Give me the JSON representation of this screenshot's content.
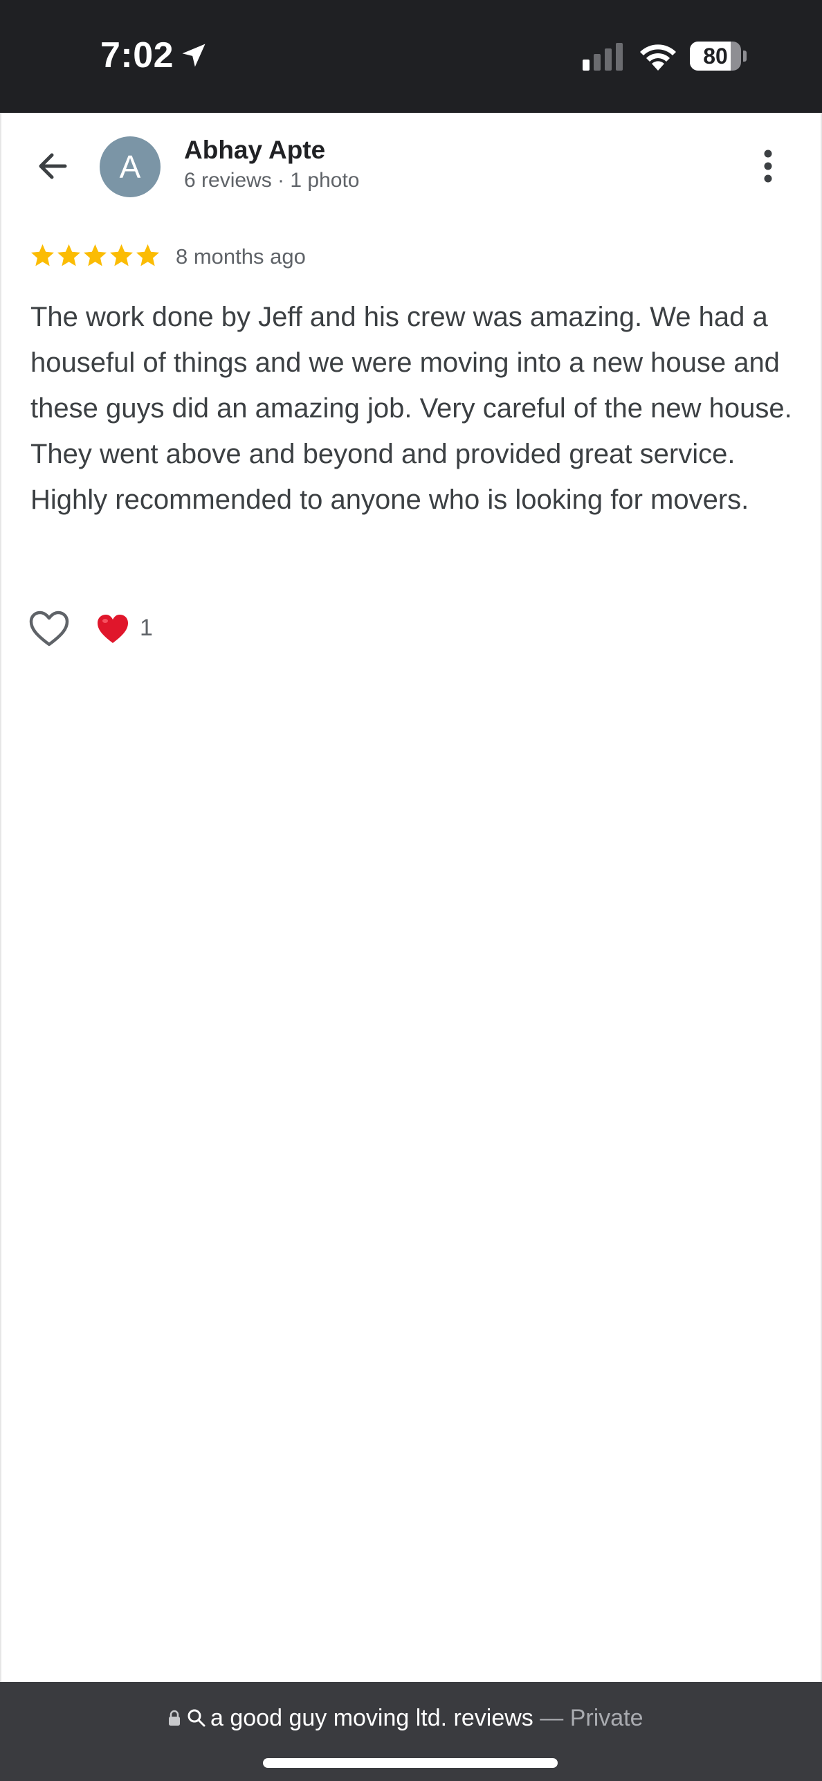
{
  "status_bar": {
    "time": "7:02",
    "battery": "80",
    "battery_level": 0.8,
    "icons": [
      "location-arrow-icon",
      "cellular-signal-icon",
      "wifi-icon",
      "battery-icon"
    ]
  },
  "header": {
    "avatar_letter": "A",
    "name": "Abhay Apte",
    "meta": "6 reviews · 1 photo",
    "icons": [
      "back-arrow-icon",
      "more-vert-icon"
    ]
  },
  "review": {
    "rating": 5,
    "max_rating": 5,
    "date": "8 months ago",
    "text": "The work done by Jeff and his crew was amazing. We had a houseful of things and we were moving into a new house and these guys did an amazing job. Very careful of the new house. They went above and beyond and provided great service. Highly recommended to anyone who is looking for movers.",
    "reaction_count": "1",
    "icons": [
      "heart-outline-icon",
      "red-heart-icon"
    ]
  },
  "browser_bar": {
    "url_text": "a good guy moving ltd. reviews",
    "separator": " — ",
    "private_label": "Private",
    "icons": [
      "lock-icon",
      "search-icon"
    ]
  },
  "colors": {
    "status_bar_bg": "#1f2023",
    "star": "#fbbc04",
    "avatar_bg": "#7b95a6",
    "bottom_bar_bg": "#3a3b3f",
    "heart_red": "#e0162b"
  }
}
